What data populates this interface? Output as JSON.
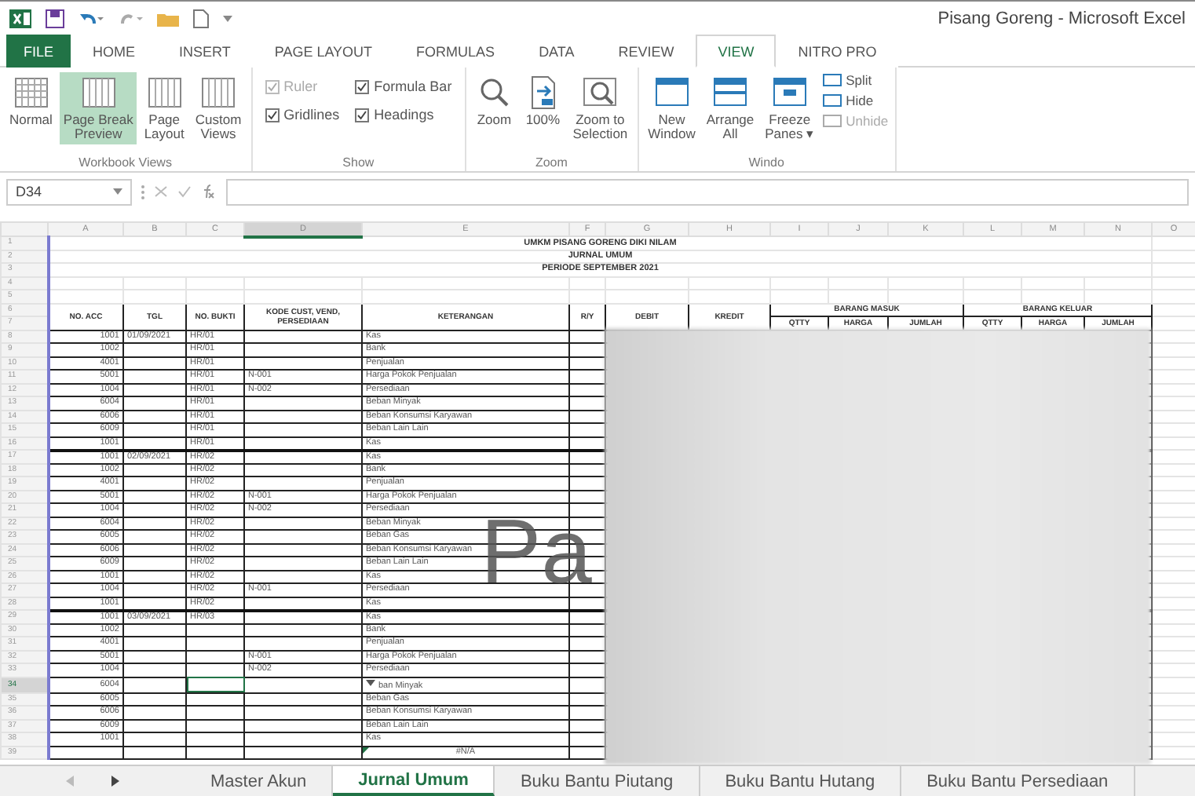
{
  "title_bar": {
    "title": "Pisang Goreng - Microsoft Excel"
  },
  "ribbon_tabs": [
    {
      "label": "FILE",
      "kind": "file",
      "selected": false
    },
    {
      "label": "HOME",
      "kind": "tab",
      "selected": false
    },
    {
      "label": "INSERT",
      "kind": "tab",
      "selected": false
    },
    {
      "label": "PAGE LAYOUT",
      "kind": "tab",
      "selected": false
    },
    {
      "label": "FORMULAS",
      "kind": "tab",
      "selected": false
    },
    {
      "label": "DATA",
      "kind": "tab",
      "selected": false
    },
    {
      "label": "REVIEW",
      "kind": "tab",
      "selected": false
    },
    {
      "label": "VIEW",
      "kind": "tab",
      "selected": true
    },
    {
      "label": "NITRO PRO",
      "kind": "tab",
      "selected": false
    }
  ],
  "ribbon_groups": [
    {
      "label": "Workbook Views",
      "kind": "views",
      "items": [
        {
          "lines": [
            "Normal"
          ],
          "selected": false
        },
        {
          "lines": [
            "Page Break",
            "Preview"
          ],
          "selected": true
        },
        {
          "lines": [
            "Page",
            "Layout"
          ],
          "selected": false
        },
        {
          "lines": [
            "Custom",
            "Views"
          ],
          "selected": false
        }
      ]
    },
    {
      "label": "Show",
      "kind": "checks",
      "items": [
        {
          "label": "Ruler",
          "checked": true,
          "disabled": true
        },
        {
          "label": "Formula Bar",
          "checked": true,
          "disabled": false
        },
        {
          "label": "Gridlines",
          "checked": true,
          "disabled": false
        },
        {
          "label": "Headings",
          "checked": true,
          "disabled": false
        }
      ]
    },
    {
      "label": "Zoom",
      "kind": "zoom",
      "items": [
        {
          "lines": [
            "Zoom"
          ]
        },
        {
          "lines": [
            "100%"
          ]
        },
        {
          "lines": [
            "Zoom to",
            "Selection"
          ]
        }
      ]
    },
    {
      "label": "Windo",
      "kind": "window",
      "items": [
        {
          "lines": [
            "New",
            "Window"
          ]
        },
        {
          "lines": [
            "Arrange",
            "All"
          ]
        },
        {
          "lines": [
            "Freeze",
            "Panes ▾"
          ]
        }
      ],
      "small": [
        {
          "label": "Split",
          "disabled": false
        },
        {
          "label": "Hide",
          "disabled": false
        },
        {
          "label": "Unhide",
          "disabled": true
        }
      ]
    }
  ],
  "formula_bar": {
    "name_box": "D34"
  },
  "sheet": {
    "columns": [
      {
        "label": "A",
        "selected": false
      },
      {
        "label": "B",
        "selected": false
      },
      {
        "label": "C",
        "selected": false
      },
      {
        "label": "D",
        "selected": true
      },
      {
        "label": "E",
        "selected": false
      },
      {
        "label": "F",
        "selected": false
      },
      {
        "label": "G",
        "selected": false
      },
      {
        "label": "H",
        "selected": false
      },
      {
        "label": "I",
        "selected": false
      },
      {
        "label": "J",
        "selected": false
      },
      {
        "label": "K",
        "selected": false
      },
      {
        "label": "L",
        "selected": false
      },
      {
        "label": "M",
        "selected": false
      },
      {
        "label": "N",
        "selected": false
      },
      {
        "label": "O",
        "selected": false
      }
    ],
    "title_rows": [
      {
        "number": "1",
        "title": "UMKM PISANG GORENG DIKI NILAM",
        "selected": false
      },
      {
        "number": "2",
        "title": "JURNAL UMUM",
        "selected": false
      },
      {
        "number": "3",
        "title": "PERIODE SEPTEMBER 2021",
        "selected": false
      },
      {
        "number": "4",
        "selected": false
      },
      {
        "number": "5",
        "selected": false
      }
    ],
    "header": {
      "numbers": [
        "6",
        "7"
      ],
      "cells": [
        "NO. ACC",
        "TGL",
        "NO. BUKTI",
        "KODE CUST, VEND, PERSEDIAAN",
        "KETERANGAN",
        "R/Y",
        "DEBIT",
        "KREDIT"
      ],
      "groups": [
        {
          "label": "BARANG MASUK",
          "subs": [
            "QTTY",
            "HARGA",
            "JUMLAH"
          ]
        },
        {
          "label": "BARANG KELUAR",
          "subs": [
            "QTTY",
            "HARGA",
            "JUMLAH"
          ]
        }
      ]
    },
    "page_label": "Pa",
    "rows": [
      {
        "number": "8",
        "selected": false,
        "no_acc": "1001",
        "tgl": "01/09/2021",
        "no_bukti": "HR/01",
        "keterangan": "Kas"
      },
      {
        "number": "9",
        "selected": false,
        "no_acc": "1002",
        "no_bukti": "HR/01",
        "keterangan": "Bank"
      },
      {
        "number": "10",
        "selected": false,
        "no_acc": "4001",
        "no_bukti": "HR/01",
        "keterangan": "Penjualan"
      },
      {
        "number": "11",
        "selected": false,
        "no_acc": "5001",
        "no_bukti": "HR/01",
        "kode": "N-001",
        "keterangan": "Harga Pokok Penjualan"
      },
      {
        "number": "12",
        "selected": false,
        "no_acc": "1004",
        "no_bukti": "HR/01",
        "kode": "N-002",
        "keterangan": "Persediaan"
      },
      {
        "number": "13",
        "selected": false,
        "no_acc": "6004",
        "no_bukti": "HR/01",
        "keterangan": "Beban Minyak"
      },
      {
        "number": "14",
        "selected": false,
        "no_acc": "6006",
        "no_bukti": "HR/01",
        "keterangan": "Beban Konsumsi Karyawan"
      },
      {
        "number": "15",
        "selected": false,
        "no_acc": "6009",
        "no_bukti": "HR/01",
        "keterangan": "Beban Lain Lain"
      },
      {
        "number": "16",
        "selected": false,
        "no_acc": "1001",
        "no_bukti": "HR/01",
        "keterangan": "Kas"
      },
      {
        "number": "17",
        "selected": false,
        "no_acc": "1001",
        "tgl": "02/09/2021",
        "no_bukti": "HR/02",
        "keterangan": "Kas"
      },
      {
        "number": "18",
        "selected": false,
        "no_acc": "1002",
        "no_bukti": "HR/02",
        "keterangan": "Bank"
      },
      {
        "number": "19",
        "selected": false,
        "no_acc": "4001",
        "no_bukti": "HR/02",
        "keterangan": "Penjualan"
      },
      {
        "number": "20",
        "selected": false,
        "no_acc": "5001",
        "no_bukti": "HR/02",
        "kode": "N-001",
        "keterangan": "Harga Pokok Penjualan"
      },
      {
        "number": "21",
        "selected": false,
        "no_acc": "1004",
        "no_bukti": "HR/02",
        "kode": "N-002",
        "keterangan": "Persediaan"
      },
      {
        "number": "22",
        "selected": false,
        "no_acc": "6004",
        "no_bukti": "HR/02",
        "keterangan": "Beban Minyak"
      },
      {
        "number": "23",
        "selected": false,
        "no_acc": "6005",
        "no_bukti": "HR/02",
        "keterangan": "Beban Gas"
      },
      {
        "number": "24",
        "selected": false,
        "no_acc": "6006",
        "no_bukti": "HR/02",
        "keterangan": "Beban Konsumsi Karyawan"
      },
      {
        "number": "25",
        "selected": false,
        "no_acc": "6009",
        "no_bukti": "HR/02",
        "keterangan": "Beban Lain Lain"
      },
      {
        "number": "26",
        "selected": false,
        "no_acc": "1001",
        "no_bukti": "HR/02",
        "keterangan": "Kas"
      },
      {
        "number": "27",
        "selected": false,
        "no_acc": "1004",
        "no_bukti": "HR/02",
        "kode": "N-001",
        "keterangan": "Persediaan"
      },
      {
        "number": "28",
        "selected": false,
        "no_acc": "1001",
        "no_bukti": "HR/02",
        "keterangan": "Kas"
      },
      {
        "number": "29",
        "selected": false,
        "no_acc": "1001",
        "tgl": "03/09/2021",
        "no_bukti": "HR/03",
        "keterangan": "Kas"
      },
      {
        "number": "30",
        "selected": false,
        "no_acc": "1002",
        "keterangan": "Bank"
      },
      {
        "number": "31",
        "selected": false,
        "no_acc": "4001",
        "keterangan": "Penjualan"
      },
      {
        "number": "32",
        "selected": false,
        "no_acc": "5001",
        "kode": "N-001",
        "keterangan": "Harga Pokok Penjualan"
      },
      {
        "number": "33",
        "selected": false,
        "no_acc": "1004",
        "kode": "N-002",
        "keterangan": "Persediaan"
      },
      {
        "number": "34",
        "selected": true,
        "no_acc": "6004",
        "keterangan": "ban Minyak",
        "dropdown": true
      },
      {
        "number": "35",
        "selected": false,
        "no_acc": "6005",
        "keterangan": "Beban Gas"
      },
      {
        "number": "36",
        "selected": false,
        "no_acc": "6006",
        "keterangan": "Beban Konsumsi Karyawan"
      },
      {
        "number": "37",
        "selected": false,
        "no_acc": "6009",
        "keterangan": "Beban Lain Lain"
      },
      {
        "number": "38",
        "selected": false,
        "no_acc": "1001",
        "keterangan": "Kas"
      },
      {
        "number": "39",
        "selected": false,
        "keterangan": "#N/A",
        "error_flag": true
      }
    ]
  },
  "sheet_tabs": [
    {
      "label": "Master Akun",
      "selected": false
    },
    {
      "label": "Jurnal Umum",
      "selected": true
    },
    {
      "label": "Buku Bantu Piutang",
      "selected": false
    },
    {
      "label": "Buku Bantu Hutang",
      "selected": false
    },
    {
      "label": "Buku Bantu Persediaan",
      "selected": false
    }
  ]
}
